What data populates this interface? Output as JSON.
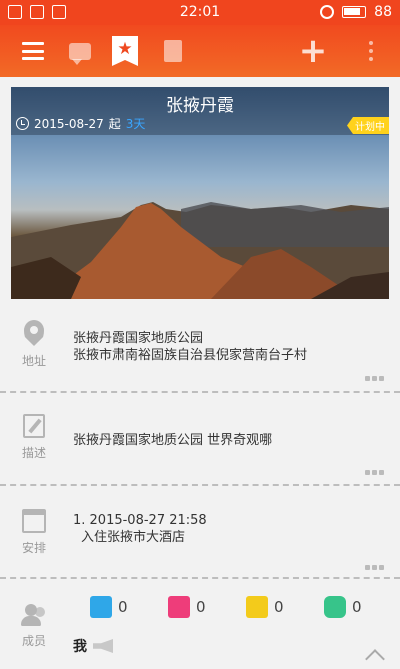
{
  "status_bar": {
    "time": "22:01",
    "battery": "88"
  },
  "toolbar": {
    "menu_icon": "menu-icon",
    "chat_icon": "chat-icon",
    "favorite_icon": "star-badge-icon",
    "clipboard_icon": "clipboard-icon",
    "add_icon": "plus-icon",
    "more_icon": "more-vertical-icon",
    "accent_color": "#f0451e"
  },
  "banner": {
    "title": "张掖丹霞",
    "date": "2015-08-27",
    "start_label": "起",
    "duration": "3天",
    "status_tag": "计划中"
  },
  "address": {
    "label": "地址",
    "line1": "张掖丹霞国家地质公园",
    "line2": "张掖市肃南裕固族自治县倪家营南台子村"
  },
  "description": {
    "label": "描述",
    "text": "张掖丹霞国家地质公园 世界奇观哪"
  },
  "schedule": {
    "label": "安排",
    "line1": "1. 2015-08-27 21:58",
    "line2": "入住张掖市大酒店"
  },
  "members": {
    "label": "成员",
    "counts": [
      {
        "icon": "flight-icon",
        "color": "#2fa7e8",
        "count": "0"
      },
      {
        "icon": "bus-stop-icon",
        "color": "#ee3d7a",
        "count": "0"
      },
      {
        "icon": "train-icon",
        "color": "#f3cb1b",
        "count": "0"
      },
      {
        "icon": "car-icon",
        "color": "#37c48a",
        "count": "0"
      }
    ],
    "me_label": "我"
  }
}
